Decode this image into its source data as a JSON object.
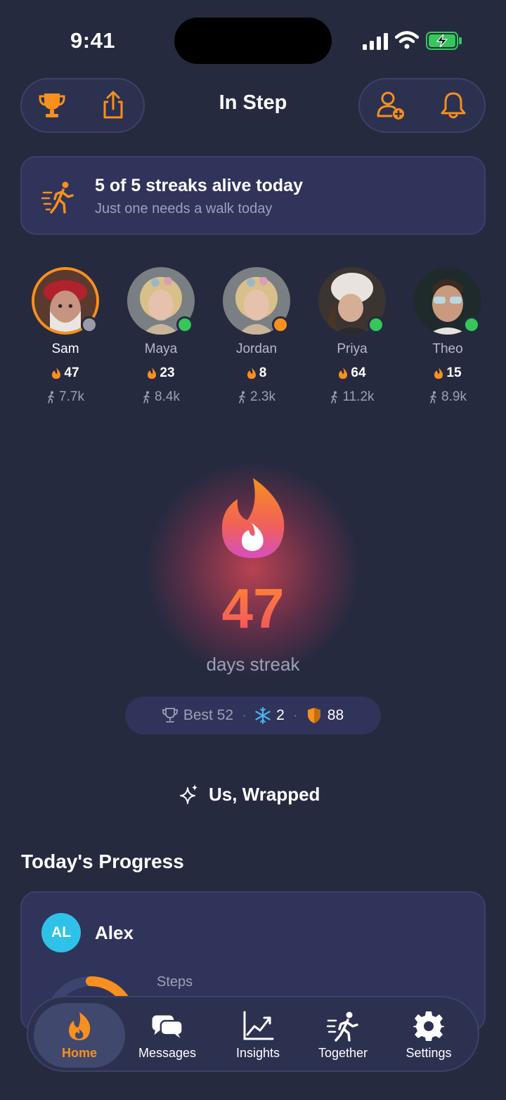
{
  "status_bar": {
    "time": "9:41"
  },
  "header": {
    "title": "In Step",
    "left_icons": [
      "trophy-icon",
      "share-icon"
    ],
    "right_icons": [
      "add-friend-icon",
      "bell-icon"
    ]
  },
  "colors": {
    "accent": "#f7901e",
    "background": "#262a3f",
    "card": "#30345a",
    "online": "#35c759",
    "away": "#f7901e",
    "offline": "#9a9aa8"
  },
  "banner": {
    "title": "5 of 5 streaks alive today",
    "subtitle": "Just one needs a walk today"
  },
  "friends": [
    {
      "name": "Sam",
      "streak": "47",
      "steps": "7.7k",
      "status": "offline",
      "selected": true
    },
    {
      "name": "Maya",
      "streak": "23",
      "steps": "8.4k",
      "status": "online",
      "selected": false
    },
    {
      "name": "Jordan",
      "streak": "8",
      "steps": "2.3k",
      "status": "away",
      "selected": false
    },
    {
      "name": "Priya",
      "streak": "64",
      "steps": "11.2k",
      "status": "online",
      "selected": false
    },
    {
      "name": "Theo",
      "streak": "15",
      "steps": "8.9k",
      "status": "online",
      "selected": false
    }
  ],
  "hero": {
    "streak": "47",
    "label": "days streak"
  },
  "stats": {
    "best": "Best 52",
    "freezes": "2",
    "shield": "88"
  },
  "wrapped": {
    "label": "Us, Wrapped"
  },
  "progress": {
    "title": "Today's Progress",
    "user_initials": "AL",
    "user_name": "Alex",
    "steps_label": "Steps",
    "ring_fraction": 0.3
  },
  "tabs": [
    {
      "label": "Home",
      "icon": "flame-icon",
      "active": true
    },
    {
      "label": "Messages",
      "icon": "chat-icon",
      "active": false
    },
    {
      "label": "Insights",
      "icon": "chart-icon",
      "active": false
    },
    {
      "label": "Together",
      "icon": "walkers-icon",
      "active": false
    },
    {
      "label": "Settings",
      "icon": "gear-icon",
      "active": false
    }
  ]
}
